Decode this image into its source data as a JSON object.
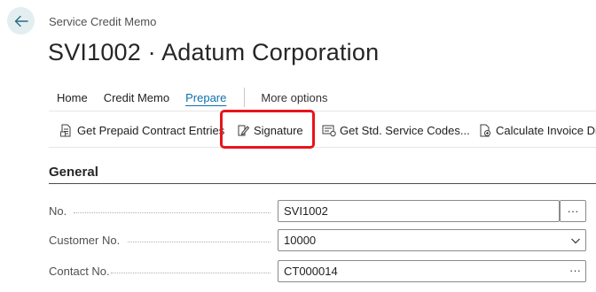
{
  "breadcrumb": "Service Credit Memo",
  "title": "SVI1002 · Adatum Corporation",
  "tabs": [
    {
      "label": "Home"
    },
    {
      "label": "Credit Memo"
    },
    {
      "label": "Prepare"
    },
    {
      "label": "More options"
    }
  ],
  "actions": [
    {
      "label": "Get Prepaid Contract Entries",
      "icon": "document-list-icon"
    },
    {
      "label": "Signature",
      "icon": "sign-document-icon"
    },
    {
      "label": "Get Std. Service Codes...",
      "icon": "service-codes-icon"
    },
    {
      "label": "Calculate Invoice Dis",
      "icon": "calculate-icon"
    }
  ],
  "section": {
    "title": "General"
  },
  "fields": {
    "no": {
      "label": "No.",
      "value": "SVI1002"
    },
    "customer_no": {
      "label": "Customer No.",
      "value": "10000"
    },
    "contact_no": {
      "label": "Contact No.",
      "value": "CT000014"
    }
  },
  "colors": {
    "accent": "#0f6fa8",
    "highlight": "#e8141b",
    "back_bg": "#e3eef1"
  }
}
